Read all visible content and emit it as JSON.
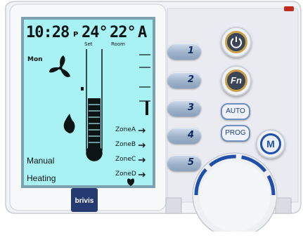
{
  "display": {
    "time": "10:28",
    "time_suffix": "P",
    "set_temp": "24°",
    "room_temp": "22°",
    "mode_letter": "A",
    "set_label": "Set",
    "room_label": "Room",
    "day": "Mon",
    "zones": [
      "ZoneA",
      "ZoneB",
      "ZoneC",
      "ZoneD"
    ],
    "control_mode": "Manual",
    "operation": "Heating",
    "backlight_color": "#a8f2f4"
  },
  "buttons": {
    "zone_numbers": [
      "1",
      "2",
      "3",
      "4",
      "5"
    ],
    "power_icon": "power-icon",
    "fn_label": "Fn",
    "auto_label": "AUTO",
    "prog_label": "PROG",
    "menu_label": "M"
  },
  "brand": {
    "logo_text": "brivis"
  },
  "colors": {
    "body": "#eef0f4",
    "accent_blue": "#1f4fa8",
    "gold_ring": "#c9a24a",
    "brand_navy": "#263a72",
    "led_red": "#c22b1f"
  }
}
